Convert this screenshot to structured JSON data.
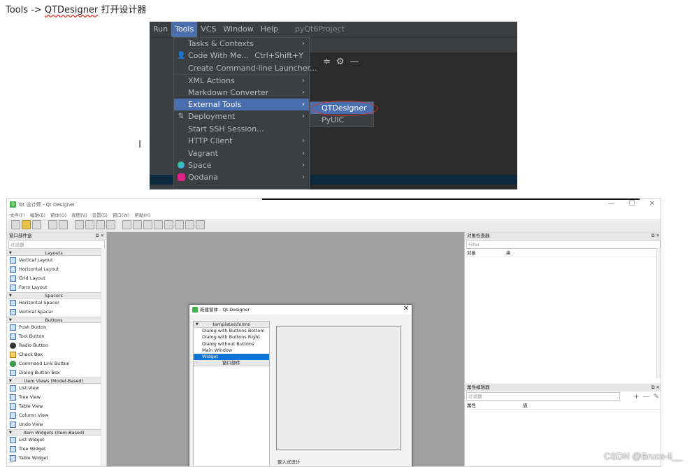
{
  "caption": {
    "prefix": "Tools -> ",
    "link": "QTDesigner",
    "suffix": " 打开设计器"
  },
  "ide": {
    "menubar": [
      "Run",
      "Tools",
      "VCS",
      "Window",
      "Help"
    ],
    "active_menu": "Tools",
    "project": "pyQt6Project",
    "tools_menu": [
      {
        "label": "Tasks & Contexts",
        "submenu": true
      },
      {
        "label": "Code With Me...",
        "shortcut": "Ctrl+Shift+Y",
        "icon": "user-icon"
      },
      {
        "label": "Create Command-line Launcher..."
      },
      {
        "label": "XML Actions",
        "submenu": true
      },
      {
        "label": "Markdown Converter",
        "submenu": true
      },
      {
        "label": "External Tools",
        "submenu": true,
        "selected": true
      },
      {
        "label": "Deployment",
        "submenu": true,
        "icon": "sync-icon"
      },
      {
        "label": "Start SSH Session..."
      },
      {
        "label": "HTTP Client",
        "submenu": true
      },
      {
        "label": "Vagrant",
        "submenu": true
      },
      {
        "label": "Space",
        "submenu": true,
        "icon": "space-icon"
      },
      {
        "label": "Qodana",
        "submenu": true,
        "icon": "qodana-icon"
      }
    ],
    "external_tools": [
      {
        "label": "QTDesigner",
        "selected": true
      },
      {
        "label": "PyUIC"
      }
    ],
    "colors": {
      "selection": "#4b6eaf",
      "menu_bg": "#3c3f41",
      "highlight_oval": "#d9352f"
    }
  },
  "designer": {
    "window_title": "Qt 设计师 - Qt Designer",
    "menus": [
      "文件(F)",
      "编辑(E)",
      "窗体(O)",
      "视图(V)",
      "设置(S)",
      "窗口(W)",
      "帮助(H)"
    ],
    "widget_box": {
      "title": "窗口部件盒",
      "filter_placeholder": "过滤器",
      "categories": [
        {
          "name": "Layouts",
          "items": [
            "Vertical Layout",
            "Horizontal Layout",
            "Grid Layout",
            "Form Layout"
          ]
        },
        {
          "name": "Spacers",
          "items": [
            "Horizontal Spacer",
            "Vertical Spacer"
          ]
        },
        {
          "name": "Buttons",
          "items": [
            "Push Button",
            "Tool Button",
            "Radio Button",
            "Check Box",
            "Command Link Button",
            "Dialog Button Box"
          ]
        },
        {
          "name": "Item Views (Model-Based)",
          "items": [
            "List View",
            "Tree View",
            "Table View",
            "Column View",
            "Undo View"
          ]
        },
        {
          "name": "Item Widgets (Item-Based)",
          "items": [
            "List Widget",
            "Tree Widget",
            "Table Widget"
          ]
        }
      ]
    },
    "new_form_dialog": {
      "title": "新建窗体 - Qt Designer",
      "group_templates": "templates\\forms",
      "templates": [
        "Dialog with Buttons Bottom",
        "Dialog with Buttons Right",
        "Dialog without Buttons",
        "Main Window",
        "Widget"
      ],
      "selected_template": "Widget",
      "group_widgets": "窗口部件",
      "embedded_label": "嵌入式设计"
    },
    "object_inspector": {
      "title": "对象检查器",
      "filter_placeholder": "Filter",
      "columns": [
        "对象",
        "类"
      ]
    },
    "property_editor": {
      "title": "属性编辑器",
      "filter_placeholder": "过滤器",
      "columns": [
        "属性",
        "值"
      ]
    }
  },
  "watermark": "CSDN @Bruce-li__"
}
